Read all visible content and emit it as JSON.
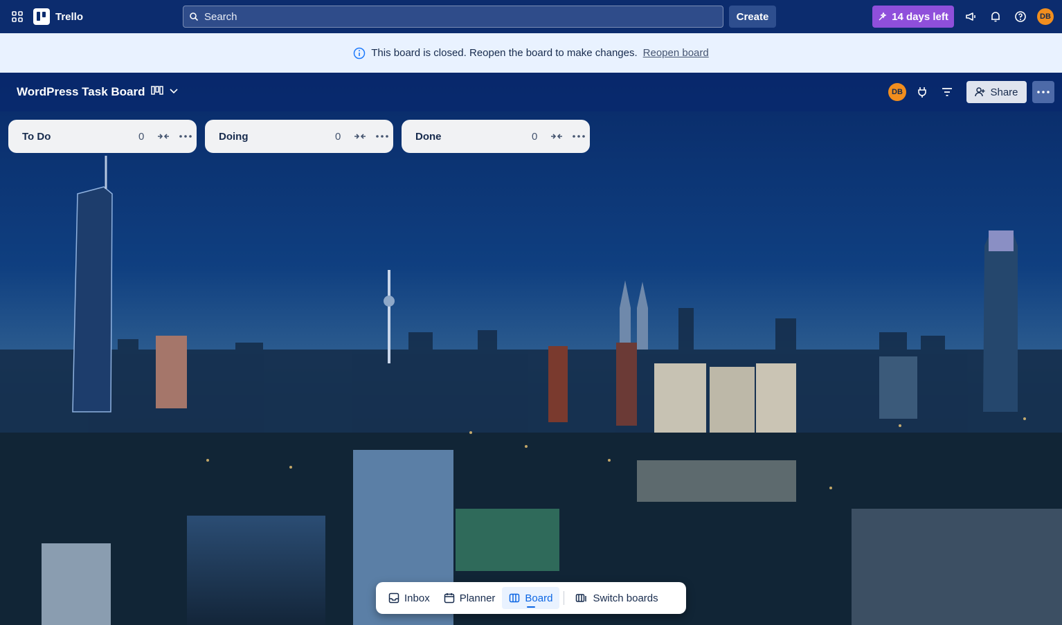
{
  "topnav": {
    "app_name": "Trello",
    "search_placeholder": "Search",
    "create_label": "Create",
    "trial_label": "14 days left",
    "avatar_initials": "DB"
  },
  "banner": {
    "message": "This board is closed. Reopen the board to make changes.",
    "link_label": "Reopen board"
  },
  "board": {
    "title": "WordPress Task Board",
    "member_initials": "DB",
    "share_label": "Share"
  },
  "lists": [
    {
      "title": "To Do",
      "count": "0"
    },
    {
      "title": "Doing",
      "count": "0"
    },
    {
      "title": "Done",
      "count": "0"
    }
  ],
  "bottom_bar": {
    "items": [
      {
        "label": "Inbox",
        "icon": "inbox-icon"
      },
      {
        "label": "Planner",
        "icon": "calendar-icon"
      },
      {
        "label": "Board",
        "icon": "board-icon",
        "active": true
      },
      {
        "label": "Switch boards",
        "icon": "switch-boards-icon"
      }
    ]
  },
  "colors": {
    "nav": "#0c2c6e",
    "trial": "#8f4fdb",
    "avatar": "#f18e1e",
    "banner": "#e9f2ff",
    "active": "#0c66e4"
  }
}
